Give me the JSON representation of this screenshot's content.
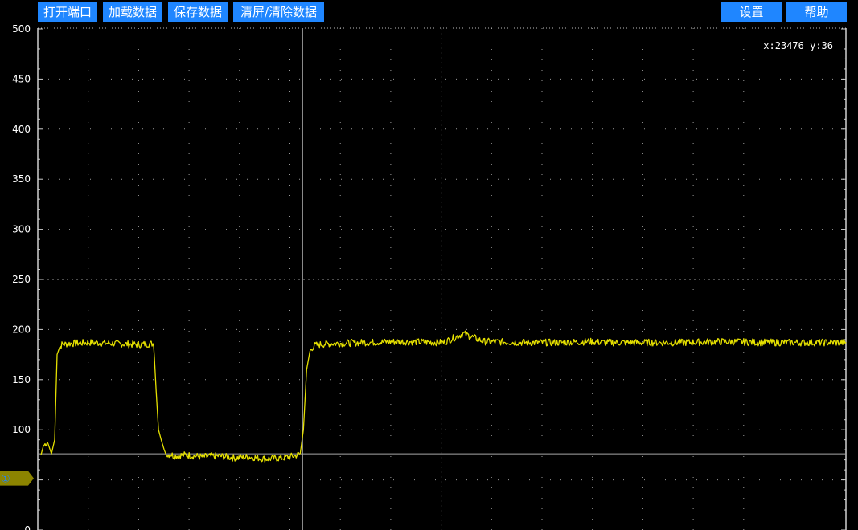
{
  "toolbar": {
    "open_port": "打开端口",
    "load_data": "加载数据",
    "save_data": "保存数据",
    "clear": "清屏/清除数据",
    "settings": "设置",
    "help": "帮助"
  },
  "cursor_readout": "x:23476 y:36",
  "channel_marker": "①",
  "colors": {
    "background": "#000000",
    "button": "#1f86ff",
    "trace": "#e5e000",
    "grid": "#9a9a9a",
    "cursor": "#a8a8a8",
    "channel_marker": "#8c8400"
  },
  "chart_data": {
    "type": "line",
    "title": "",
    "xlabel": "",
    "ylabel": "",
    "ylim": [
      0,
      500
    ],
    "yticks": [
      0,
      50,
      100,
      150,
      200,
      250,
      300,
      350,
      400,
      450,
      500
    ],
    "xlim": [
      0,
      1000
    ],
    "grid": true,
    "legend": "none",
    "cursor": {
      "x": 325,
      "y": 76
    },
    "channel_marker_value": 50,
    "series": [
      {
        "name": "",
        "color": "#e5e000",
        "x": [
          0,
          3,
          8,
          13,
          17,
          20,
          23,
          26,
          35,
          60,
          90,
          120,
          140,
          143,
          146,
          150,
          153,
          156,
          160,
          165,
          180,
          200,
          220,
          240,
          260,
          280,
          300,
          315,
          322,
          326,
          330,
          334,
          337,
          340,
          345,
          360,
          400,
          450,
          500,
          525,
          550,
          600,
          650,
          680,
          700,
          750,
          800,
          850,
          900,
          950,
          1000
        ],
        "y": [
          75,
          84,
          88,
          76,
          90,
          175,
          182,
          185,
          186,
          187,
          186,
          185,
          186,
          140,
          100,
          88,
          80,
          74,
          76,
          74,
          75,
          73,
          74,
          72,
          73,
          71,
          72,
          74,
          76,
          100,
          160,
          178,
          182,
          184,
          185,
          186,
          187,
          188,
          187,
          196,
          188,
          187,
          187,
          188,
          187,
          187,
          187,
          188,
          187,
          187,
          187
        ]
      }
    ]
  }
}
